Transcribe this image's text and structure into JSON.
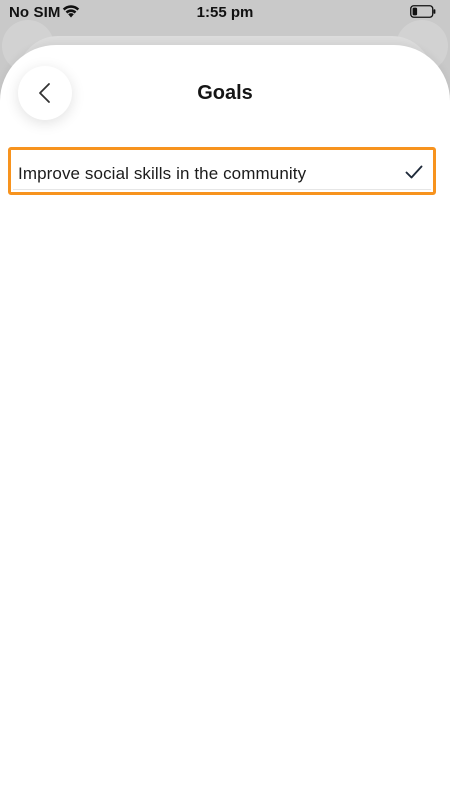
{
  "status_bar": {
    "carrier": "No SIM",
    "time": "1:55 pm",
    "icons": [
      "wifi-icon",
      "battery-icon"
    ]
  },
  "header": {
    "title": "Goals",
    "back_icon": "chevron-left-icon"
  },
  "goals": [
    {
      "label": "Improve social skills in the community",
      "selected": true,
      "icon": "checkmark-icon"
    }
  ],
  "colors": {
    "highlight": "#f7931e",
    "text": "#1c1c1c",
    "check": "#1f2a3a"
  }
}
